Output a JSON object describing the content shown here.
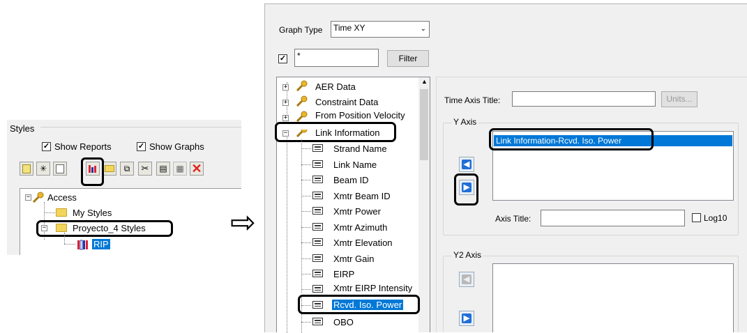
{
  "left_panel": {
    "title": "Styles",
    "show_reports": {
      "label": "Show Reports",
      "checked": true
    },
    "show_graphs": {
      "label": "Show Graphs",
      "checked": true
    },
    "toolbar_icons": [
      "new-report-icon",
      "new-style-icon",
      "new-graph-icon",
      "graph-style-icon",
      "open-folder-icon",
      "copy-icon",
      "cut-icon",
      "paste-icon",
      "properties-icon",
      "delete-icon"
    ],
    "tree": {
      "root": "Access",
      "items": [
        "My Styles",
        "Proyecto_4 Styles"
      ],
      "leaf": "RIP"
    }
  },
  "arrow_glyph": "⇨",
  "window": {
    "graph_type_label": "Graph Type",
    "graph_type_value": "Time XY",
    "filter_value": "*",
    "filter_checked": true,
    "filter_button": "Filter",
    "tree": {
      "groups": [
        "AER Data",
        "Constraint Data",
        "From Position Velocity",
        "Link Information"
      ],
      "link_items": [
        "Strand Name",
        "Link Name",
        "Beam ID",
        "Xmtr Beam ID",
        "Xmtr Power",
        "Xmtr Azimuth",
        "Xmtr Elevation",
        "Xmtr Gain",
        "EIRP",
        "Xmtr EIRP Intensity",
        "Rcvd. Iso. Power",
        "OBO"
      ],
      "selected": "Rcvd. Iso. Power"
    },
    "time_axis_title_label": "Time Axis Title:",
    "units_button": "Units...",
    "y_axis": {
      "label": "Y Axis",
      "entries": [
        "Link Information-Rcvd. Iso. Power"
      ],
      "axis_title_label": "Axis Title:",
      "log10_label": "Log10"
    },
    "y2_axis": {
      "label": "Y2 Axis"
    }
  },
  "colors": {
    "selection": "#0078d7",
    "highlight": "#000000",
    "folder": "#f2d55c",
    "delete": "#e0201b"
  }
}
